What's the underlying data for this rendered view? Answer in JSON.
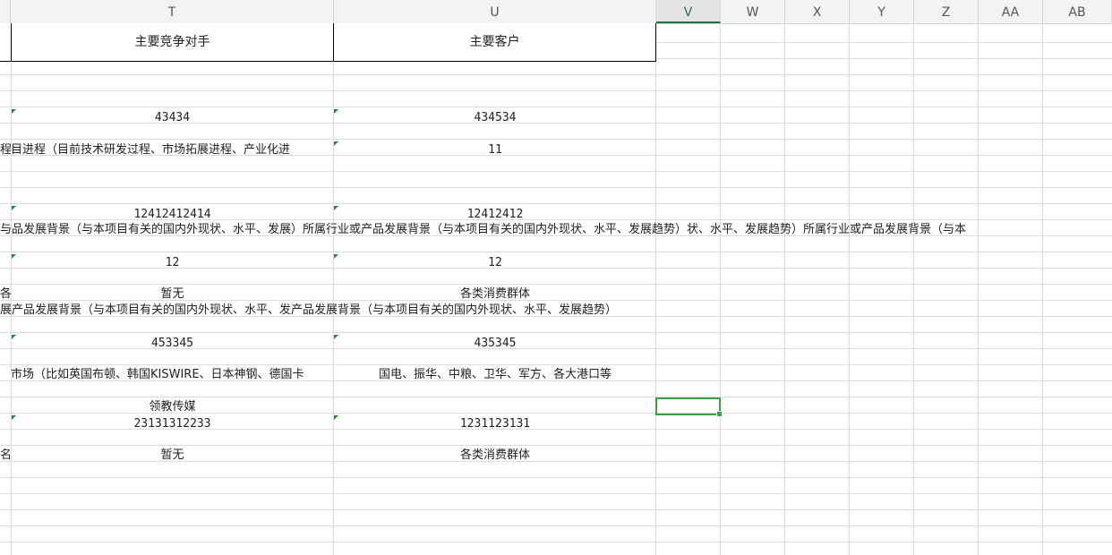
{
  "columns": [
    "T",
    "U",
    "V",
    "W",
    "X",
    "Y",
    "Z",
    "AA",
    "AB"
  ],
  "header": {
    "t": "主要竞争对手",
    "u": "主要客户"
  },
  "rows": {
    "r1": {
      "t": "43434",
      "u": "434534"
    },
    "r2": {
      "s": "程",
      "t": "目进程（目前技术研发过程、市场拓展进程、产业化进",
      "u": "11"
    },
    "r3": {
      "t": "12412412414",
      "u": "12412412"
    },
    "r4": {
      "line": "与品发展背景（与本项目有关的国内外现状、水平、发展）所属行业或产品发展背景（与本项目有关的国内外现状、水平、发展趋势）状、水平、发展趋势）所属行业或产品发展背景（与本"
    },
    "r5": {
      "t": "12",
      "u": "12"
    },
    "r6": {
      "s": "各t",
      "t": "暂无",
      "u": "各类消费群体"
    },
    "r7": {
      "line": "展产品发展背景（与本项目有关的国内外现状、水平、发产品发展背景（与本项目有关的国内外现状、水平、发展趋势）"
    },
    "r8": {
      "t": "453345",
      "u": "435345"
    },
    "r9": {
      "t": "市场（比如英国布顿、韩国KISWIRE、日本神钢、德国卡",
      "u": "国电、振华、中粮、卫华、军方、各大港口等"
    },
    "r10": {
      "t": "领教传媒"
    },
    "r11": {
      "t": "23131312233",
      "u": "1231123131"
    },
    "r12": {
      "s": "名",
      "t": "暂无",
      "u": "各类消费群体"
    }
  }
}
